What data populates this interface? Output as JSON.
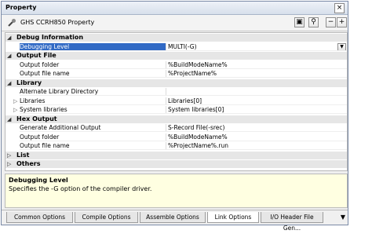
{
  "window": {
    "title": "Property"
  },
  "toolbar": {
    "label": "GHS CCRH850 Property"
  },
  "grid": {
    "rows": [
      {
        "type": "category",
        "label": "Debug Information",
        "expanded": true
      },
      {
        "type": "property",
        "name": "Debugging Level",
        "value": "MULTI(-G)",
        "selected": true,
        "dropdown": true
      },
      {
        "type": "category",
        "label": "Output File",
        "expanded": true
      },
      {
        "type": "property",
        "name": "Output folder",
        "value": "%BuildModeName%"
      },
      {
        "type": "property",
        "name": "Output file name",
        "value": "%ProjectName%"
      },
      {
        "type": "category",
        "label": "Library",
        "expanded": true
      },
      {
        "type": "property",
        "name": "Alternate Library Directory",
        "value": ""
      },
      {
        "type": "property",
        "name": "Libraries",
        "value": "Libraries[0]",
        "collapsible": true
      },
      {
        "type": "property",
        "name": "System libraries",
        "value": "System libraries[0]",
        "collapsible": true
      },
      {
        "type": "category",
        "label": "Hex Output",
        "expanded": true
      },
      {
        "type": "property",
        "name": "Generate Additional Output",
        "value": "S-Record File(-srec)"
      },
      {
        "type": "property",
        "name": "Output folder",
        "value": "%BuildModeName%"
      },
      {
        "type": "property",
        "name": "Output file name",
        "value": "%ProjectName%.run"
      },
      {
        "type": "category",
        "label": "List",
        "expanded": false
      },
      {
        "type": "category",
        "label": "Others",
        "expanded": false
      }
    ]
  },
  "description": {
    "title": "Debugging Level",
    "text": "Specifies the -G option of the compiler driver."
  },
  "tabs": [
    {
      "label": "Common Options",
      "active": false
    },
    {
      "label": "Compile Options",
      "active": false
    },
    {
      "label": "Assemble Options",
      "active": false
    },
    {
      "label": "Link Options",
      "active": true
    },
    {
      "label": "I/O Header File Gen...",
      "active": false
    }
  ],
  "colors": {
    "selection": "#316ac5",
    "description_bg": "#ffffe1",
    "category_bg": "#e6e6e6"
  }
}
